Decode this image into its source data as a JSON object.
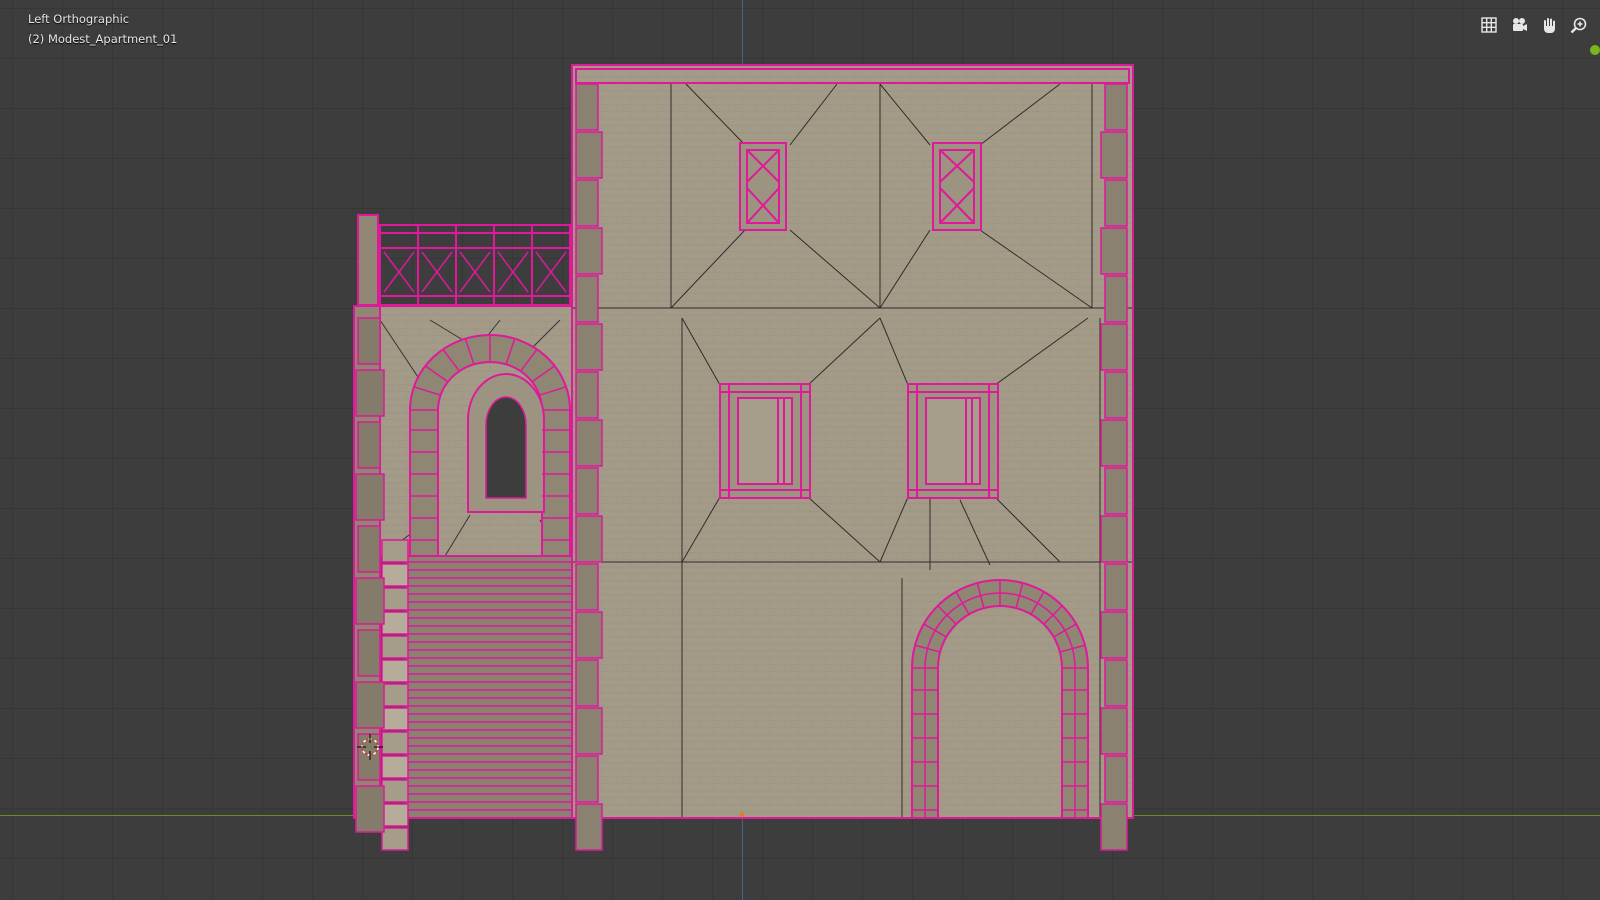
{
  "viewport": {
    "view_name": "Left Orthographic",
    "object_name": "(2) Modest_Apartment_01"
  },
  "nav_gizmos": [
    {
      "name": "grid-toggle-icon"
    },
    {
      "name": "camera-view-icon"
    },
    {
      "name": "pan-hand-icon"
    },
    {
      "name": "zoom-icon"
    }
  ],
  "colors": {
    "background": "#3d3d3d",
    "grid": "#363636",
    "wall": "#a09684",
    "selection": "#e0189a",
    "x_axis": "#6b8e23",
    "z_axis": "#3f6fa0"
  }
}
